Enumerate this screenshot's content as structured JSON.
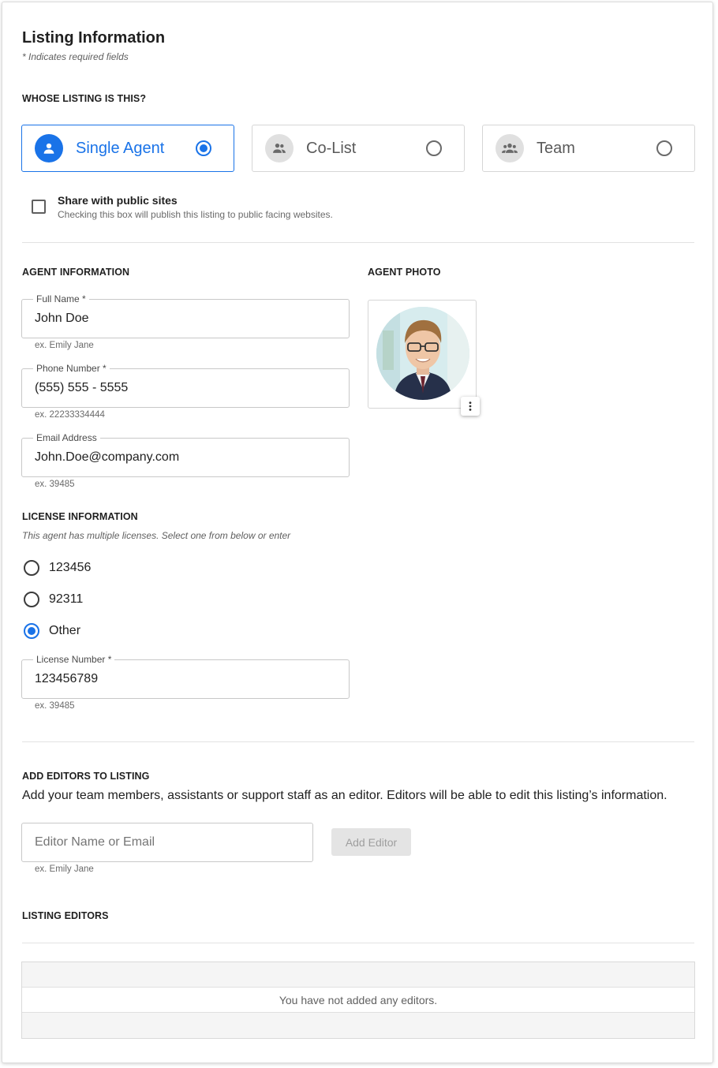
{
  "header": {
    "title": "Listing Information",
    "required_note": "* Indicates required  fields"
  },
  "listing_owner": {
    "section_label": "WHOSE LISTING IS THIS?",
    "options": [
      {
        "label": "Single Agent",
        "icon": "person-icon",
        "selected": true
      },
      {
        "label": "Co-List",
        "icon": "people-icon",
        "selected": false
      },
      {
        "label": "Team",
        "icon": "group-icon",
        "selected": false
      }
    ],
    "share": {
      "title": "Share with public sites",
      "subtitle": "Checking this box will publish this listing to public facing websites.",
      "checked": false
    }
  },
  "agent_info": {
    "section_label": "AGENT INFORMATION",
    "full_name": {
      "label": "Full Name *",
      "value": "John Doe",
      "hint": "ex. Emily Jane"
    },
    "phone": {
      "label": "Phone Number *",
      "value": "(555) 555 - 5555",
      "hint": "ex. 22233334444"
    },
    "email": {
      "label": "Email Address",
      "value": "John.Doe@company.com",
      "hint": "ex. 39485"
    }
  },
  "agent_photo": {
    "section_label": "AGENT PHOTO",
    "menu_icon": "more-vert-icon"
  },
  "license": {
    "section_label": "LICENSE INFORMATION",
    "subtitle": "This agent has multiple licenses. Select one from below or enter",
    "options": [
      {
        "label": "123456",
        "selected": false
      },
      {
        "label": "92311",
        "selected": false
      },
      {
        "label": "Other",
        "selected": true
      }
    ],
    "number": {
      "label": "License Number *",
      "value": "123456789",
      "hint": "ex. 39485"
    }
  },
  "editors": {
    "section_label": "ADD EDITORS TO LISTING",
    "description": "Add your team members, assistants or support staff as an editor. Editors will be able to edit this listing’s information.",
    "input_placeholder": "Editor Name or Email",
    "input_hint": "ex. Emily Jane",
    "add_button": "Add Editor"
  },
  "listing_editors": {
    "section_label": "LISTING EDITORS",
    "empty_message": "You have not added any editors."
  },
  "colors": {
    "accent": "#1a73e8",
    "border": "#d6d6d6",
    "muted_text": "#6a6a6a"
  }
}
